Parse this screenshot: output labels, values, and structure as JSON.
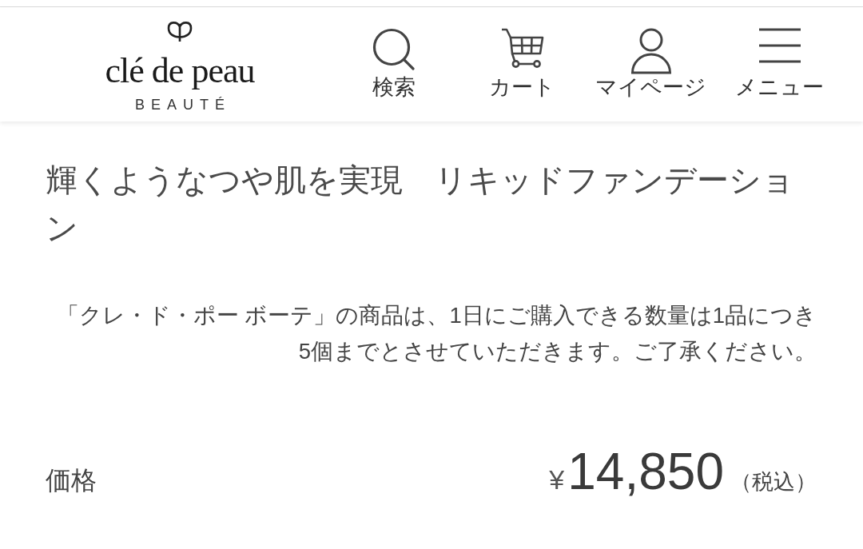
{
  "header": {
    "logo": {
      "wordmark": "clé de peau",
      "subtitle": "BEAUTÉ"
    },
    "nav": [
      {
        "kind": "search",
        "label": "検索"
      },
      {
        "kind": "cart",
        "label": "カート"
      },
      {
        "kind": "account",
        "label": "マイページ"
      },
      {
        "kind": "menu",
        "label": "メニュー"
      }
    ]
  },
  "product": {
    "title": "輝くようなつや肌を実現　リキッドファンデーション",
    "notice": "「クレ・ド・ポー ボーテ」の商品は、1日にご購入できる数量は1品につき5個までとさせていただきます。ご了承ください。",
    "price": {
      "label": "価格",
      "currency": "¥",
      "amount": "14,850",
      "tax_note": "（税込）"
    }
  }
}
